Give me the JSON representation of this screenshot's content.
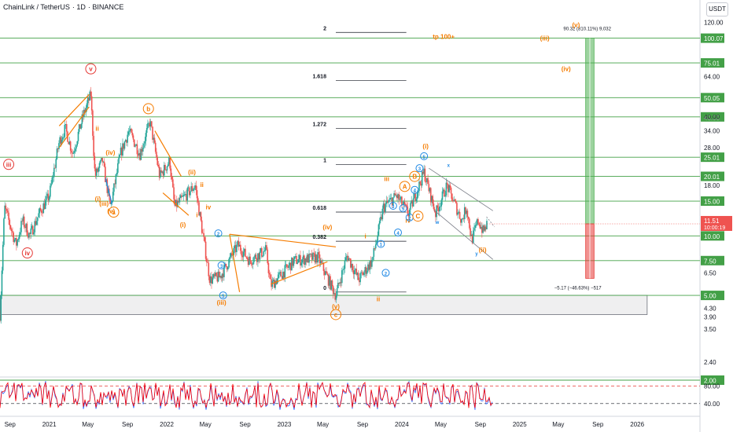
{
  "header": {
    "symbol": "ChainLink / TetherUS",
    "interval": "1D",
    "exchange": "BINANCE",
    "currency_button": "USDT"
  },
  "colors": {
    "level_line": "#43a047",
    "candle_up": "#26a69a",
    "candle_down": "#ef5350",
    "wave_red": "#e53935",
    "wave_orange": "#f57c00",
    "wave_blue": "#1e88e5",
    "fib": "#131722",
    "target_green": "#4caf50",
    "stop_red": "#e53935",
    "osc_red": "#ff0000",
    "osc_blue": "#2962ff"
  },
  "chart_data": {
    "type": "candlestick",
    "symbol": "ChainLink / TetherUS",
    "interval": "1D",
    "y_scale": "log",
    "ylim": [
      3.6,
      130
    ],
    "x_range": [
      "2020-08-01",
      "2026-07-15"
    ],
    "y_ticks": [
      "120.00",
      "100.07",
      "75.01",
      "64.00",
      "50.05",
      "40.00",
      "34.00",
      "28.00",
      "25.01",
      "20.01",
      "18.00",
      "15.00",
      "11.51",
      "10.00",
      "7.50",
      "6.50",
      "5.00",
      "4.30",
      "3.90",
      "3.50",
      "2.40",
      "2.00",
      "80.00",
      "40.00"
    ],
    "y_tick_values": [
      120,
      64,
      40,
      34,
      28,
      18,
      6.5,
      4.3,
      3.9
    ],
    "x_ticks": [
      {
        "label": "Sep",
        "date": "2020-09-01"
      },
      {
        "label": "2021",
        "date": "2021-01-01"
      },
      {
        "label": "May",
        "date": "2021-05-01"
      },
      {
        "label": "Sep",
        "date": "2021-09-01"
      },
      {
        "label": "2022",
        "date": "2022-01-01"
      },
      {
        "label": "May",
        "date": "2022-05-01"
      },
      {
        "label": "Sep",
        "date": "2022-09-01"
      },
      {
        "label": "2023",
        "date": "2023-01-01"
      },
      {
        "label": "May",
        "date": "2023-05-01"
      },
      {
        "label": "Sep",
        "date": "2023-09-01"
      },
      {
        "label": "2024",
        "date": "2024-01-01"
      },
      {
        "label": "May",
        "date": "2024-05-01"
      },
      {
        "label": "Sep",
        "date": "2024-09-01"
      },
      {
        "label": "2025",
        "date": "2025-01-01"
      },
      {
        "label": "May",
        "date": "2025-05-01"
      },
      {
        "label": "Sep",
        "date": "2025-09-01"
      },
      {
        "label": "2026",
        "date": "2026-01-01"
      }
    ],
    "levels": [
      {
        "value": 100.07,
        "label": "100.07"
      },
      {
        "value": 75.01,
        "label": "75.01"
      },
      {
        "value": 50.05,
        "label": "50.05"
      },
      {
        "value": 40.0,
        "label": "40.00"
      },
      {
        "value": 25.01,
        "label": "25.01"
      },
      {
        "value": 20.01,
        "label": "20.01"
      },
      {
        "value": 15.0,
        "label": "15.00"
      },
      {
        "value": 10.0,
        "label": "10.00"
      },
      {
        "value": 7.5,
        "label": "7.50"
      },
      {
        "value": 5.0,
        "label": "5.00"
      },
      {
        "value": 2.0,
        "label": "2.00"
      }
    ],
    "current_price": {
      "value": 11.51,
      "label": "11.51",
      "countdown": "10:00:19"
    },
    "price_path": [
      {
        "date": "2020-08-01",
        "v": 4.0
      },
      {
        "date": "2020-08-15",
        "v": 14
      },
      {
        "date": "2020-09-20",
        "v": 9
      },
      {
        "date": "2020-10-10",
        "v": 12
      },
      {
        "date": "2020-11-01",
        "v": 10
      },
      {
        "date": "2020-12-01",
        "v": 13
      },
      {
        "date": "2021-01-01",
        "v": 16
      },
      {
        "date": "2021-02-01",
        "v": 30
      },
      {
        "date": "2021-02-20",
        "v": 35
      },
      {
        "date": "2021-03-15",
        "v": 26
      },
      {
        "date": "2021-04-15",
        "v": 40
      },
      {
        "date": "2021-05-10",
        "v": 52
      },
      {
        "date": "2021-05-23",
        "v": 20
      },
      {
        "date": "2021-06-15",
        "v": 24
      },
      {
        "date": "2021-07-10",
        "v": 14
      },
      {
        "date": "2021-08-10",
        "v": 26
      },
      {
        "date": "2021-09-05",
        "v": 34
      },
      {
        "date": "2021-10-10",
        "v": 26
      },
      {
        "date": "2021-11-10",
        "v": 38
      },
      {
        "date": "2021-12-10",
        "v": 20
      },
      {
        "date": "2022-01-10",
        "v": 24
      },
      {
        "date": "2022-01-25",
        "v": 14
      },
      {
        "date": "2022-03-30",
        "v": 18
      },
      {
        "date": "2022-05-15",
        "v": 6
      },
      {
        "date": "2022-06-15",
        "v": 6.2
      },
      {
        "date": "2022-08-10",
        "v": 9
      },
      {
        "date": "2022-09-15",
        "v": 7.5
      },
      {
        "date": "2022-11-05",
        "v": 8.5
      },
      {
        "date": "2022-11-20",
        "v": 5.6
      },
      {
        "date": "2023-02-01",
        "v": 7.5
      },
      {
        "date": "2023-04-15",
        "v": 7.8
      },
      {
        "date": "2023-06-10",
        "v": 5.0
      },
      {
        "date": "2023-07-15",
        "v": 8.0
      },
      {
        "date": "2023-08-20",
        "v": 6.0
      },
      {
        "date": "2023-10-01",
        "v": 7.5
      },
      {
        "date": "2023-11-05",
        "v": 14
      },
      {
        "date": "2023-12-15",
        "v": 16
      },
      {
        "date": "2024-01-22",
        "v": 13
      },
      {
        "date": "2024-03-10",
        "v": 21
      },
      {
        "date": "2024-04-15",
        "v": 13
      },
      {
        "date": "2024-05-20",
        "v": 18
      },
      {
        "date": "2024-07-05",
        "v": 12
      },
      {
        "date": "2024-07-20",
        "v": 14
      },
      {
        "date": "2024-08-05",
        "v": 9.5
      },
      {
        "date": "2024-08-25",
        "v": 12
      },
      {
        "date": "2024-09-10",
        "v": 10.5
      },
      {
        "date": "2024-09-22",
        "v": 11.51
      }
    ],
    "fib_levels": [
      {
        "label": "2",
        "value": 107
      },
      {
        "label": "1.618",
        "value": 61
      },
      {
        "label": "1.272",
        "value": 35
      },
      {
        "label": "1",
        "value": 23
      },
      {
        "label": "0.618",
        "value": 13.2
      },
      {
        "label": "0.382",
        "value": 9.4
      },
      {
        "label": "0",
        "value": 5.2
      }
    ],
    "fib_x": [
      "2023-06-10",
      "2024-01-15"
    ],
    "target_box": {
      "x": [
        "2025-07-25",
        "2025-08-20"
      ],
      "entry": 11.51,
      "target": 100.07,
      "stop": 6.1,
      "target_label": "90.32 (810.11%) 9,032",
      "stop_label": "−5.17 (−46.63%) −517"
    },
    "support_zone": {
      "top": 5.0,
      "bottom": 4.0,
      "x": [
        "2020-08-01",
        "2026-02-01"
      ]
    },
    "annotations": [
      {
        "text": "v",
        "date": "2021-05-10",
        "value": 70,
        "color": "wave_red",
        "circled": true
      },
      {
        "text": "iii",
        "date": "2020-08-28",
        "value": 23,
        "color": "wave_red",
        "circled": true
      },
      {
        "text": "iv",
        "date": "2020-10-25",
        "value": 8.2,
        "color": "wave_red",
        "circled": true
      },
      {
        "text": "b",
        "date": "2021-11-05",
        "value": 44,
        "color": "wave_orange",
        "circled": true
      },
      {
        "text": "a",
        "date": "2021-07-20",
        "value": 13.2,
        "color": "wave_orange",
        "circled": true
      },
      {
        "text": "c",
        "date": "2023-06-10",
        "value": 4.0,
        "color": "wave_orange",
        "circled": true
      },
      {
        "text": "(v)",
        "date": "2023-06-10",
        "value": 4.4,
        "color": "wave_orange",
        "circled": false
      },
      {
        "text": "(i)",
        "date": "2021-06-01",
        "value": 15.4,
        "color": "wave_orange",
        "circled": false
      },
      {
        "text": "(iii)",
        "date": "2021-06-20",
        "value": 14.6,
        "color": "wave_orange",
        "circled": false
      },
      {
        "text": "(v)",
        "date": "2021-07-12",
        "value": 13.4,
        "color": "wave_orange",
        "circled": false
      },
      {
        "text": "(iv)",
        "date": "2021-07-10",
        "value": 26.5,
        "color": "wave_orange",
        "circled": false
      },
      {
        "text": "(ii)",
        "date": "2022-03-20",
        "value": 21,
        "color": "wave_orange",
        "circled": false
      },
      {
        "text": "(i)",
        "date": "2022-02-20",
        "value": 11.4,
        "color": "wave_orange",
        "circled": false
      },
      {
        "text": "(iii)",
        "date": "2022-06-20",
        "value": 4.6,
        "color": "wave_orange",
        "circled": false
      },
      {
        "text": "(iv)",
        "date": "2023-05-15",
        "value": 11.1,
        "color": "wave_orange",
        "circled": false
      },
      {
        "text": "(i)",
        "date": "2024-03-15",
        "value": 28.5,
        "color": "wave_orange",
        "circled": false
      },
      {
        "text": "(ii)",
        "date": "2024-09-08",
        "value": 8.5,
        "color": "wave_orange",
        "circled": false
      },
      {
        "text": "(iii)",
        "date": "2025-03-20",
        "value": 100.0,
        "color": "wave_orange",
        "circled": false
      },
      {
        "text": "(iv)",
        "date": "2025-05-25",
        "value": 70.0,
        "color": "wave_orange",
        "circled": false
      },
      {
        "text": "(v)",
        "date": "2025-06-25",
        "value": 117,
        "color": "wave_orange",
        "circled": false
      },
      {
        "text": "tp 100+",
        "date": "2024-05-10",
        "value": 102,
        "color": "wave_orange",
        "circled": false
      },
      {
        "text": "iii",
        "date": "2023-11-15",
        "value": 19.5,
        "color": "wave_orange",
        "circled": false
      },
      {
        "text": "iv",
        "date": "2024-01-20",
        "value": 12.0,
        "color": "wave_orange",
        "circled": false
      },
      {
        "text": "ii",
        "date": "2023-10-20",
        "value": 4.8,
        "color": "wave_orange",
        "circled": false
      },
      {
        "text": "i",
        "date": "2023-09-10",
        "value": 10.0,
        "color": "wave_orange",
        "circled": false
      },
      {
        "text": "ii",
        "date": "2021-05-30",
        "value": 35,
        "color": "wave_orange",
        "circled": false
      },
      {
        "text": "ii",
        "date": "2022-04-20",
        "value": 18.2,
        "color": "wave_orange",
        "circled": false
      },
      {
        "text": "iv",
        "date": "2022-05-10",
        "value": 14.0,
        "color": "wave_orange",
        "circled": false
      },
      {
        "text": "i",
        "date": "2022-04-05",
        "value": 12.8,
        "color": "wave_orange",
        "circled": false
      },
      {
        "text": "1",
        "date": "2023-10-28",
        "value": 9.1,
        "color": "wave_blue",
        "circled": true
      },
      {
        "text": "2",
        "date": "2023-11-12",
        "value": 6.5,
        "color": "wave_blue",
        "circled": true
      },
      {
        "text": "3",
        "date": "2023-12-05",
        "value": 14.2,
        "color": "wave_blue",
        "circled": true
      },
      {
        "text": "4",
        "date": "2023-12-20",
        "value": 10.4,
        "color": "wave_blue",
        "circled": true
      },
      {
        "text": "5",
        "date": "2024-01-05",
        "value": 13.8,
        "color": "wave_blue",
        "circled": true
      },
      {
        "text": "3",
        "date": "2024-02-25",
        "value": 22.0,
        "color": "wave_blue",
        "circled": true
      },
      {
        "text": "5",
        "date": "2024-03-10",
        "value": 25.3,
        "color": "wave_blue",
        "circled": true
      },
      {
        "text": "2",
        "date": "2024-01-25",
        "value": 12.4,
        "color": "wave_blue",
        "circled": true
      },
      {
        "text": "4",
        "date": "2024-02-10",
        "value": 17.1,
        "color": "wave_blue",
        "circled": true
      },
      {
        "text": "x",
        "date": "2024-05-25",
        "value": 23.0,
        "color": "wave_blue",
        "circled": false
      },
      {
        "text": "y",
        "date": "2024-08-20",
        "value": 8.2,
        "color": "wave_blue",
        "circled": false
      },
      {
        "text": "w",
        "date": "2024-04-20",
        "value": 11.8,
        "color": "wave_blue",
        "circled": false
      },
      {
        "text": "2",
        "date": "2022-06-10",
        "value": 10.3,
        "color": "wave_blue",
        "circled": true
      },
      {
        "text": "3",
        "date": "2022-06-20",
        "value": 7.1,
        "color": "wave_blue",
        "circled": true
      },
      {
        "text": "5",
        "date": "2022-06-25",
        "value": 5.0,
        "color": "wave_blue",
        "circled": true
      },
      {
        "text": "A",
        "date": "2024-01-10",
        "value": 17.8,
        "color": "wave_orange",
        "circled": true
      },
      {
        "text": "B",
        "date": "2024-02-10",
        "value": 20.0,
        "color": "wave_orange",
        "circled": true
      },
      {
        "text": "C",
        "date": "2024-02-20",
        "value": 12.6,
        "color": "wave_orange",
        "circled": true
      }
    ],
    "oscillator": {
      "ylim": [
        20,
        95
      ],
      "levels": [
        {
          "value": 80,
          "label": "80.00"
        },
        {
          "value": 40,
          "label": "40.00"
        }
      ]
    }
  }
}
